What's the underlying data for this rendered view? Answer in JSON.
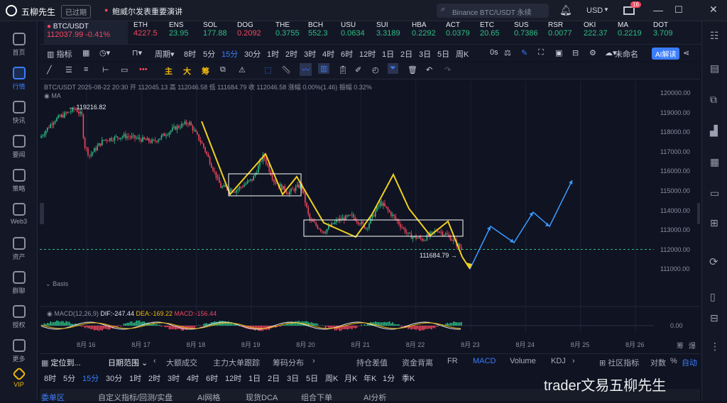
{
  "titlebar": {
    "app_name": "五柳先生",
    "badge": "已过期",
    "news": "鲍威尔发表重要演讲",
    "search_placeholder": "Binance BTC/USDT 永续",
    "currency": "USD",
    "mail_badge": "16"
  },
  "leftnav": [
    {
      "label": "首页"
    },
    {
      "label": "行情"
    },
    {
      "label": "快讯"
    },
    {
      "label": "要闻"
    },
    {
      "label": "策略"
    },
    {
      "label": "Web3"
    },
    {
      "label": "资产"
    },
    {
      "label": "群聊"
    },
    {
      "label": "授权"
    },
    {
      "label": "更多"
    },
    {
      "label": "VIP"
    }
  ],
  "tickers": [
    {
      "name": "BTC/USDT",
      "value": "112037.99",
      "change": "-0.41%"
    },
    {
      "name": "ETH",
      "value": "4227.5"
    },
    {
      "name": "ENS",
      "value": "23.95"
    },
    {
      "name": "SOL",
      "value": "177.88"
    },
    {
      "name": "DOG",
      "value": "0.2092"
    },
    {
      "name": "THE",
      "value": "0.3755"
    },
    {
      "name": "BCH",
      "value": "552.3"
    },
    {
      "name": "USU",
      "value": "0.0634"
    },
    {
      "name": "SUI",
      "value": "3.3189"
    },
    {
      "name": "HBA",
      "value": "0.2292"
    },
    {
      "name": "ACT",
      "value": "0.0379"
    },
    {
      "name": "ETC",
      "value": "20.65"
    },
    {
      "name": "SUS",
      "value": "0.7386"
    },
    {
      "name": "RSR",
      "value": "0.0077"
    },
    {
      "name": "OKI",
      "value": "222.37"
    },
    {
      "name": "MA",
      "value": "0.2219"
    },
    {
      "name": "DOT",
      "value": "3.709"
    }
  ],
  "toolbar1": {
    "indicator": "指标",
    "period": "周期",
    "timeframes": [
      "8时",
      "5分",
      "15分",
      "30分",
      "1时",
      "2时",
      "3时",
      "4时",
      "6时",
      "12时",
      "1日",
      "2日",
      "3日",
      "5日",
      "周K"
    ],
    "selected": "15分",
    "countdown": "0s",
    "unnamed": "未命名",
    "ai": "AI解读"
  },
  "toolbar2": {
    "main": "主",
    "big": "大",
    "chip": "筹"
  },
  "chart": {
    "info": "BTC/USDT 2025-08-22 20:30 开 112045.13 高 112046.58 低 111684.79 收 112046.58 涨幅 0.00%(1.46) 振幅 0.32%",
    "ma_label": "MA",
    "basis_label": "Basis",
    "high_label": "119216.82",
    "low_label": "111684.79",
    "macd_label": "MACD(12,26,9)",
    "dif": "DIF:-247.44",
    "dea": "DEA:-169.22",
    "macd": "MACD:-156.44",
    "macd_zero": "0.00",
    "y_labels": [
      "120000.00",
      "119000.00",
      "118000.00",
      "117000.00",
      "116000.00",
      "115000.00",
      "114000.00",
      "113000.00",
      "112000.00",
      "111000.00"
    ],
    "x_labels": [
      "8月 16",
      "8月 17",
      "8月 18",
      "8月 19",
      "8月 20",
      "8月 21",
      "8月 22",
      "8月 23",
      "8月 24",
      "8月 25",
      "8月 26"
    ],
    "corner_labels": [
      "筹",
      "爆"
    ]
  },
  "bottomtabs": {
    "locate": "定位到...",
    "daterange": "日期范围",
    "tabs": [
      "大额成交",
      "主力大单跟踪",
      "筹码分布",
      "持仓差值",
      "资金背离",
      "FR",
      "MACD",
      "Volume",
      "KDJ"
    ],
    "selected": "MACD",
    "community": "社区指标",
    "log": "对数",
    "pct": "%",
    "auto": "自动"
  },
  "bottomtf": [
    "8时",
    "5分",
    "15分",
    "30分",
    "1时",
    "2时",
    "3时",
    "4时",
    "6时",
    "12时",
    "1日",
    "2日",
    "3日",
    "5日",
    "周K",
    "月K",
    "年K",
    "1分",
    "季K"
  ],
  "bottombar": [
    "委单区",
    "自定义指标/回测/实盘",
    "AI网格",
    "现货DCA",
    "组合下单",
    "AI分析"
  ],
  "watermark": "trader文易五柳先生"
}
